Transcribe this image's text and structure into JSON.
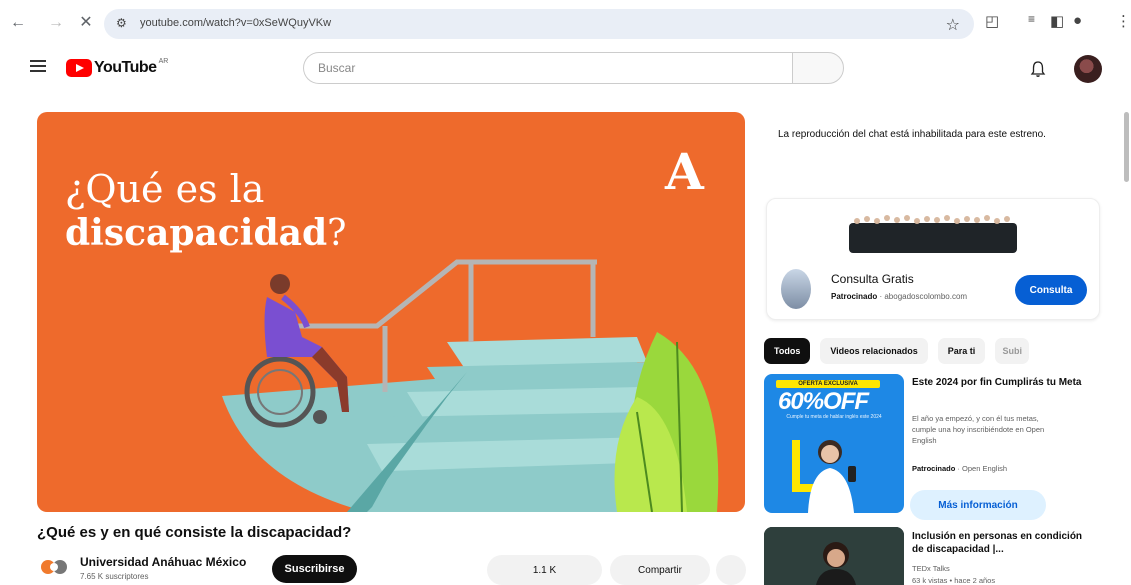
{
  "browser": {
    "url": "youtube.com/watch?v=0xSeWQuyVKw",
    "back_icon": "back-arrow-icon",
    "forward_icon": "forward-arrow-icon",
    "stop_icon": "close-icon"
  },
  "header": {
    "logo_text": "YouTube",
    "country_code": "AR",
    "search_placeholder": "Buscar"
  },
  "player": {
    "thumb_line1": "¿Qué es la",
    "thumb_line2_bold": "discapacidad",
    "thumb_line2_end": "?",
    "thumb_logo": "A",
    "colors": {
      "background": "#ee6a2c",
      "stairs": "#8ecbc9",
      "plant": "#9ad83c"
    }
  },
  "video": {
    "title": "¿Qué es y en qué consiste la discapacidad?",
    "channel_name": "Universidad Anáhuac México",
    "subscribers": "7.65 K suscriptores",
    "subscribe_label": "Suscribirse",
    "likes": "1.1 K",
    "share_label": "Compartir"
  },
  "sidebar": {
    "chat_disabled": "La reproducción del chat está inhabilitada para este estreno.",
    "ad": {
      "title": "Consulta Gratis",
      "sponsored": "Patrocinado",
      "domain": "abogadoscolombo.com",
      "cta": "Consulta"
    },
    "chips": [
      "Todos",
      "Videos relacionados",
      "Para ti",
      "Subi"
    ],
    "videos": [
      {
        "title": "Este 2024 por fin Cumplirás tu Meta",
        "desc": "El año ya empezó, y con él tus metas, cumple una hoy inscribiéndote en Open English",
        "sponsored": "Patrocinado",
        "advertiser": "Open English",
        "cta": "Más información",
        "promo_banner": "OFERTA EXCLUSIVA",
        "promo_big": "60%OFF",
        "promo_small": "Cumple tu meta de hablar inglés este 2024"
      },
      {
        "title": "Inclusión en personas en condición de discapacidad |...",
        "channel": "TEDx Talks",
        "meta": "63 k vistas • hace 2 años"
      }
    ]
  }
}
